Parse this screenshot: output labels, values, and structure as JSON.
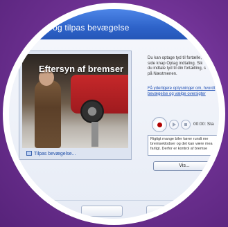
{
  "window": {
    "title": ", og tilpas bevægelse"
  },
  "preview": {
    "caption": "Eftersyn af bremser"
  },
  "motion_button": {
    "label": "Tilpas bevægelse..."
  },
  "instructions": {
    "text": "Du kan optage tyd til fortælle,\nside knap Optag indtaling. Sik\ndu indtale tyd til din fortælling, s\npå Næstmenen."
  },
  "help_link": {
    "text": "Få yderligere oplysninger om, hvordt\nbevægelse og vælge oversigter"
  },
  "recording": {
    "timer": "00:00: Sta"
  },
  "narration": {
    "text": "Rigtigt mange biler kører rundt me\nbremseklodser og det kan være mea\nfarligt. Derfor er kontrol af bremse"
  },
  "buttons": {
    "next_label": "Vis..."
  },
  "colors": {
    "background": "#6b2f8f",
    "ring": "#ffffff",
    "titlebar": "#2e63c9",
    "car": "#c6282a"
  }
}
